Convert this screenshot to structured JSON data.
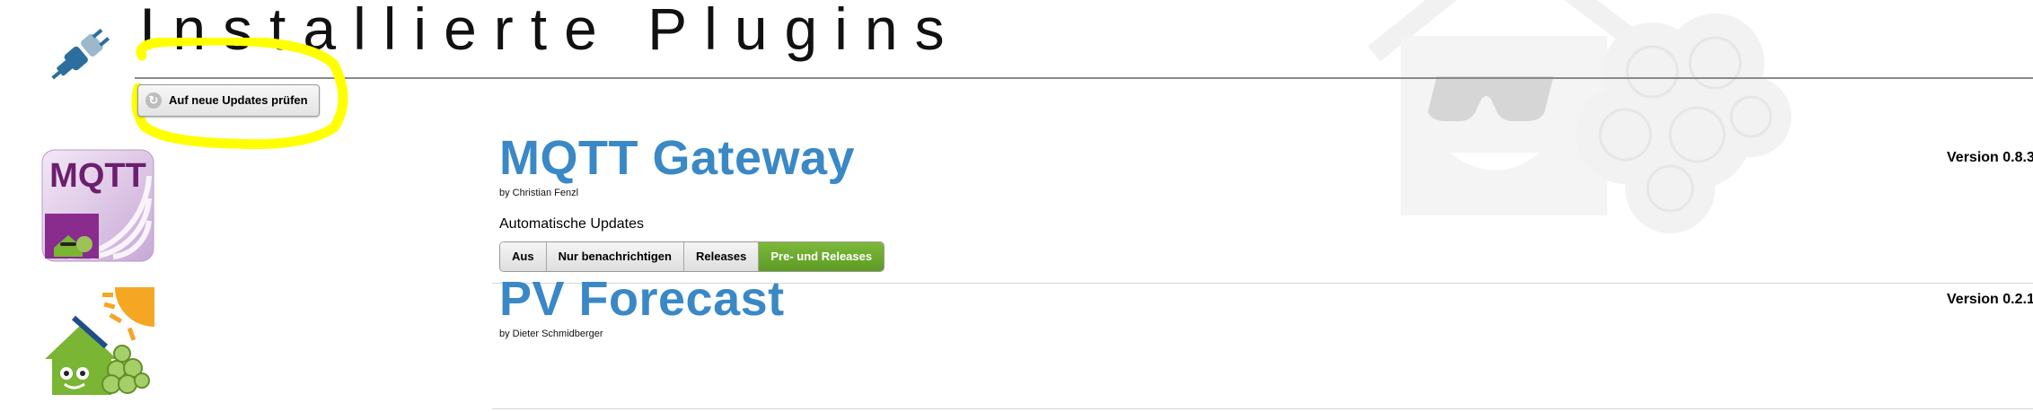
{
  "header": {
    "title": "Installierte Plugins",
    "check_updates_label": "Auf neue Updates prüfen",
    "icons": {
      "plugin": "plug-icon",
      "refresh": "refresh-icon"
    },
    "highlight_color": "#ffff00"
  },
  "plugins": [
    {
      "name": "MQTT Gateway",
      "author": "by Christian Fenzl",
      "version": "Version 0.8.3",
      "logo_text": "MQTT",
      "auto_updates": {
        "label": "Automatische Updates",
        "options": [
          "Aus",
          "Nur benachrichtigen",
          "Releases",
          "Pre- und Releases"
        ],
        "selected": "Pre- und Releases"
      }
    },
    {
      "name": "PV Forecast",
      "author": "by Dieter Schmidberger",
      "version": "Version 0.2.1"
    }
  ],
  "colors": {
    "accent": "#3a88c6",
    "active_segment": "#6aa82f",
    "plug_icon": "#2c6e9e",
    "house_green": "#7ab534",
    "sun_orange": "#f5a623"
  }
}
